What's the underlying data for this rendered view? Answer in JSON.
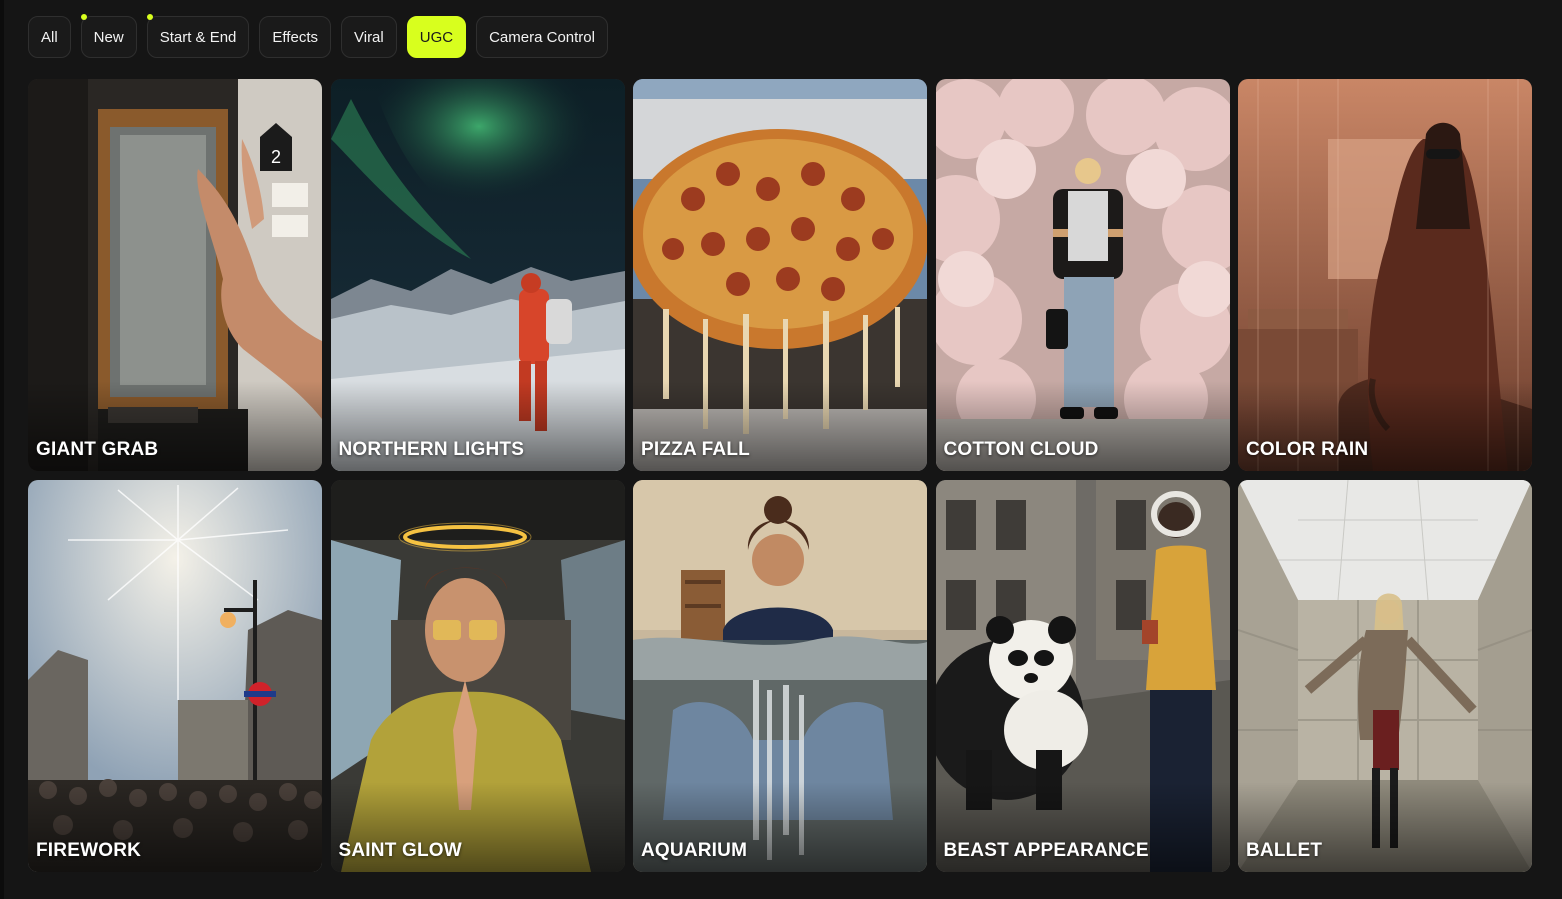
{
  "filters": [
    {
      "label": "All",
      "active": false,
      "new_dot": false
    },
    {
      "label": "New",
      "active": false,
      "new_dot": true
    },
    {
      "label": "Start & End",
      "active": false,
      "new_dot": true
    },
    {
      "label": "Effects",
      "active": false,
      "new_dot": false
    },
    {
      "label": "Viral",
      "active": false,
      "new_dot": false
    },
    {
      "label": "UGC",
      "active": true,
      "new_dot": false
    },
    {
      "label": "Camera Control",
      "active": false,
      "new_dot": false
    }
  ],
  "accent_color": "#d8ff1e",
  "cards": [
    {
      "title": "GIANT GRAB"
    },
    {
      "title": "NORTHERN LIGHTS"
    },
    {
      "title": "PIZZA FALL"
    },
    {
      "title": "COTTON CLOUD"
    },
    {
      "title": "COLOR RAIN"
    },
    {
      "title": "FIREWORK"
    },
    {
      "title": "SAINT GLOW"
    },
    {
      "title": "AQUARIUM"
    },
    {
      "title": "BEAST APPEARANCE"
    },
    {
      "title": "BALLET"
    }
  ]
}
